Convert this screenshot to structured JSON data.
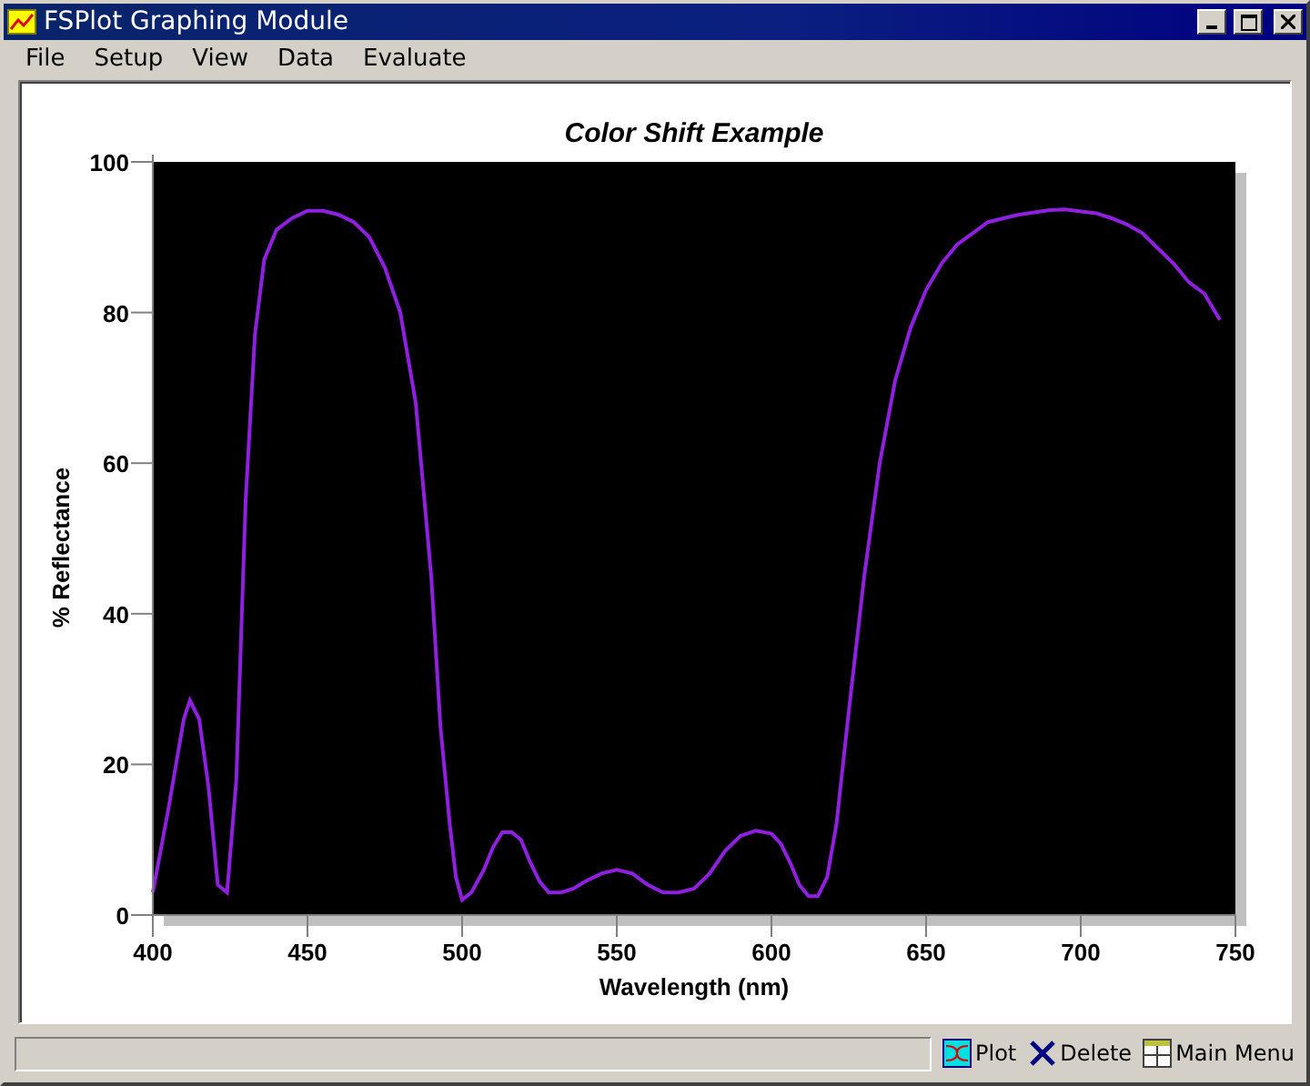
{
  "window": {
    "title": "FSPlot Graphing Module"
  },
  "menu": [
    "File",
    "Setup",
    "View",
    "Data",
    "Evaluate"
  ],
  "plot": {
    "chart_data": {
      "type": "line",
      "title": "Color Shift Example",
      "xlabel": "Wavelength (nm)",
      "ylabel": "% Reflectance",
      "xlim": [
        400,
        750
      ],
      "ylim": [
        0,
        100
      ],
      "xticks": [
        400,
        450,
        500,
        550,
        600,
        650,
        700,
        750
      ],
      "yticks": [
        0,
        20,
        40,
        60,
        80,
        100
      ],
      "x": [
        400,
        405,
        410,
        412,
        415,
        418,
        421,
        424,
        427,
        430,
        433,
        436,
        440,
        445,
        450,
        455,
        460,
        465,
        470,
        475,
        480,
        485,
        490,
        493,
        496,
        498,
        500,
        503,
        507,
        510,
        513,
        516,
        519,
        522,
        525,
        528,
        532,
        536,
        540,
        545,
        550,
        555,
        560,
        565,
        570,
        575,
        580,
        585,
        590,
        595,
        600,
        603,
        606,
        609,
        612,
        615,
        618,
        621,
        625,
        630,
        635,
        640,
        645,
        650,
        655,
        660,
        665,
        670,
        675,
        680,
        685,
        690,
        695,
        700,
        705,
        710,
        715,
        720,
        725,
        730,
        735,
        740,
        745
      ],
      "series": [
        {
          "color": "#9020e0",
          "values": [
            3,
            14,
            26,
            28.5,
            26,
            17,
            4,
            3,
            18,
            55,
            77,
            87,
            91,
            92.5,
            93.5,
            93.5,
            93,
            92,
            90,
            86,
            80,
            68,
            45,
            25,
            12,
            5,
            2,
            3,
            6,
            9,
            11,
            11,
            10,
            7,
            4.5,
            3,
            3,
            3.5,
            4.5,
            5.5,
            6,
            5.5,
            4,
            3,
            3,
            3.5,
            5.5,
            8.5,
            10.5,
            11.2,
            10.8,
            9.5,
            7,
            4,
            2.5,
            2.5,
            5,
            12,
            27,
            45,
            60,
            71,
            78,
            83,
            86.5,
            89,
            90.5,
            92,
            92.5,
            93,
            93.3,
            93.6,
            93.7,
            93.4,
            93.2,
            92.5,
            91.7,
            90.5,
            88.5,
            86.5,
            84,
            82.5,
            79
          ]
        }
      ]
    }
  },
  "status_bar": {
    "buttons": [
      {
        "kind": "plot",
        "label": "Plot"
      },
      {
        "kind": "delete",
        "label": "Delete"
      },
      {
        "kind": "menu",
        "label": "Main Menu"
      }
    ]
  }
}
